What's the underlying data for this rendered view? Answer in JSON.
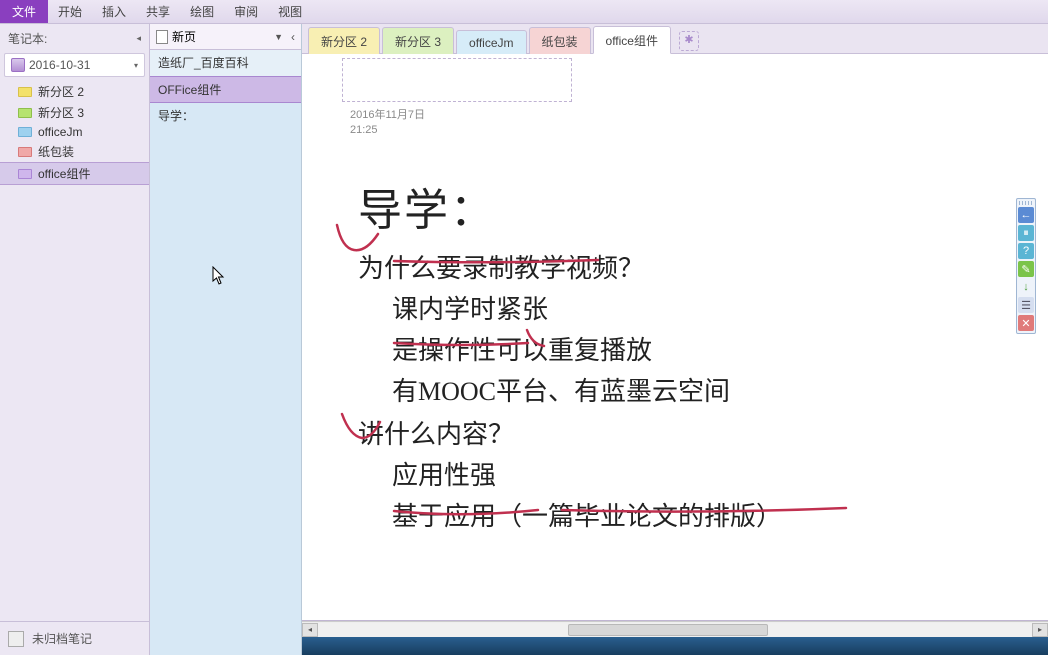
{
  "menu": {
    "file": "文件",
    "items": [
      "开始",
      "插入",
      "共享",
      "绘图",
      "审阅",
      "视图"
    ]
  },
  "notebook_panel": {
    "label": "笔记本:",
    "selected": "2016-10-31",
    "sections": [
      {
        "label": "新分区 2",
        "swatch": "sw-yellow"
      },
      {
        "label": "新分区 3",
        "swatch": "sw-green"
      },
      {
        "label": "officeJm",
        "swatch": "sw-blue"
      },
      {
        "label": "纸包装",
        "swatch": "sw-red"
      },
      {
        "label": "office组件",
        "swatch": "sw-purple"
      }
    ],
    "unfiled": "未归档笔记"
  },
  "page_panel": {
    "new_page": "新页",
    "pages": [
      {
        "label": "造纸厂_百度百科",
        "sel": false
      },
      {
        "label": "OFFice组件",
        "sel": true
      },
      {
        "label": "导学：",
        "sel": false
      }
    ]
  },
  "section_tabs": [
    {
      "label": "新分区 2",
      "cls": "t-yellow"
    },
    {
      "label": "新分区 3",
      "cls": "t-green"
    },
    {
      "label": "officeJm",
      "cls": "t-blue"
    },
    {
      "label": "纸包装",
      "cls": "t-red"
    },
    {
      "label": "office组件",
      "cls": "t-purple active"
    }
  ],
  "canvas": {
    "date": "2016年11月7日",
    "time": "21:25",
    "title": "导学：",
    "l1a": "为什么要录制教学视频？",
    "l2a": "课内学时紧张",
    "l2b": "是操作性可以重复播放",
    "l2c": "有MOOC平台、有蓝墨云空间",
    "l1b": "讲什么内容？",
    "l2d": "应用性强",
    "l2e": "基于应用（一篇毕业论文的排版）"
  },
  "float_tools": {
    "back": "←",
    "pause": "⏸",
    "help": "?",
    "globe": "✎",
    "down": "↓",
    "menu": "☰",
    "close": "✕"
  }
}
